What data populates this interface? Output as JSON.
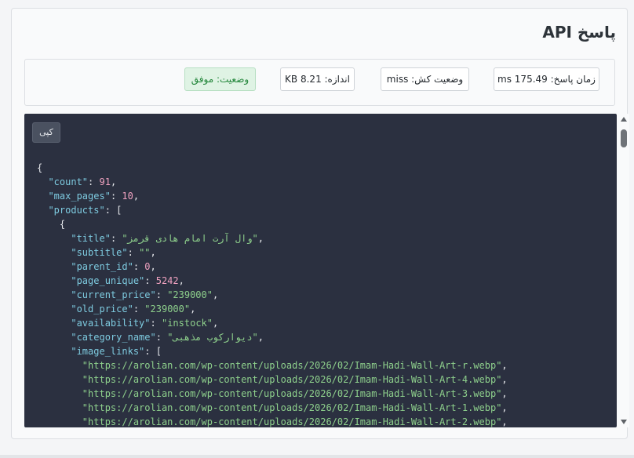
{
  "header": {
    "title": "پاسخ API"
  },
  "stats": {
    "response_time": "زمان پاسخ: 175.49 ms",
    "cache_status": "وضعیت کش: miss",
    "size": "اندازه: 8.21 KB",
    "status": "وضعیت: موفق"
  },
  "code": {
    "copy_label": "کپی",
    "lines": {
      "open": "{",
      "count_key": "\"count\"",
      "count_val": "91",
      "max_pages_key": "\"max_pages\"",
      "max_pages_val": "10",
      "products_key": "\"products\"",
      "obj_open": "{",
      "title_key": "\"title\"",
      "title_val": "\"وال آرت امام هادی قرمز\"",
      "subtitle_key": "\"subtitle\"",
      "subtitle_val": "\"\"",
      "parent_id_key": "\"parent_id\"",
      "parent_id_val": "0",
      "page_unique_key": "\"page_unique\"",
      "page_unique_val": "5242",
      "current_price_key": "\"current_price\"",
      "current_price_val": "\"239000\"",
      "old_price_key": "\"old_price\"",
      "old_price_val": "\"239000\"",
      "availability_key": "\"availability\"",
      "availability_val": "\"instock\"",
      "category_name_key": "\"category_name\"",
      "category_name_val": "\"دیوارکوب مذهبی\"",
      "image_links_key": "\"image_links\"",
      "img1": "\"https://arolian.com/wp-content/uploads/2026/02/Imam-Hadi-Wall-Art-r.webp\"",
      "img2": "\"https://arolian.com/wp-content/uploads/2026/02/Imam-Hadi-Wall-Art-4.webp\"",
      "img3": "\"https://arolian.com/wp-content/uploads/2026/02/Imam-Hadi-Wall-Art-3.webp\"",
      "img4": "\"https://arolian.com/wp-content/uploads/2026/02/Imam-Hadi-Wall-Art-1.webp\"",
      "img5": "\"https://arolian.com/wp-content/uploads/2026/02/Imam-Hadi-Wall-Art-2.webp\""
    }
  },
  "icons": {
    "scroll_up": "triangle-up-icon",
    "scroll_down": "triangle-down-icon"
  }
}
